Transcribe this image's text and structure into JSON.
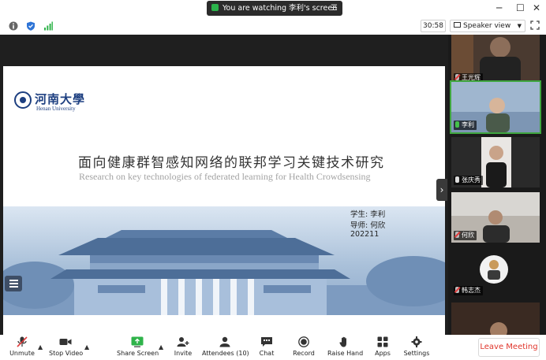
{
  "topbar": {
    "watching_text": "You are watching 李利's screen",
    "menu_icon": "hamburger-icon",
    "window_controls": [
      "minimize-icon",
      "maximize-icon",
      "close-icon"
    ]
  },
  "toolbar": {
    "timer": "30:58",
    "view_label": "Speaker view",
    "icons": [
      "info-icon",
      "shield-icon",
      "signal-icon",
      "fullscreen-icon"
    ]
  },
  "slide": {
    "logo_cn": "河南大學",
    "logo_en": "Henan University",
    "title_cn": "面向健康群智感知网络的联邦学习关键技术研究",
    "title_en": "Research on key technologies of federated learning for Health Crowdsensing",
    "student": "学生:  李利",
    "advisor": "导师:  何欣",
    "date": "202211"
  },
  "participants": [
    {
      "name": "王光辉",
      "mic": "muted",
      "active": false
    },
    {
      "name": "李利",
      "mic": "on",
      "active": true
    },
    {
      "name": "张庆秀",
      "mic": "on",
      "active": false
    },
    {
      "name": "何欣",
      "mic": "muted",
      "active": false
    },
    {
      "name": "韩志杰",
      "mic": "muted",
      "active": false
    },
    {
      "name": "",
      "mic": "muted",
      "active": false
    }
  ],
  "bottom_toolbar": {
    "unmute": "Unmute",
    "stop_video": "Stop Video",
    "share_screen": "Share Screen",
    "invite": "Invite",
    "attendees": "Attendees (10)",
    "chat": "Chat",
    "record": "Record",
    "raise_hand": "Raise Hand",
    "apps": "Apps",
    "settings": "Settings",
    "leave": "Leave Meeting"
  },
  "colors": {
    "leave_red": "#e0352b",
    "active_green": "#3fa63f",
    "university_blue": "#1d3f80",
    "watching_bg": "#2b2b2b"
  }
}
